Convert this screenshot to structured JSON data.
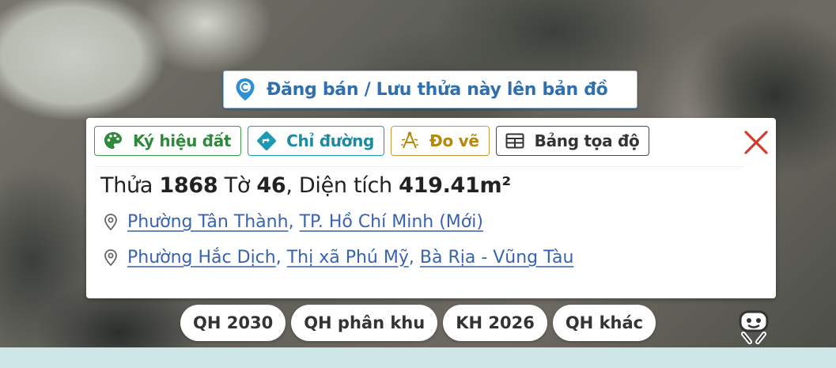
{
  "post_button": {
    "label": "Đăng bán / Lưu thửa này lên bản đồ",
    "icon": "map-pin-coin-icon",
    "color": "#2f6fae"
  },
  "toolbar": {
    "items": [
      {
        "label": "Ký hiệu đất",
        "icon": "palette-icon",
        "color": "#2e8a3b"
      },
      {
        "label": "Chỉ đường",
        "icon": "directions-icon",
        "color": "#1b8aa2"
      },
      {
        "label": "Đo vẽ",
        "icon": "measure-draw-icon",
        "color": "#b8860b"
      },
      {
        "label": "Bảng tọa độ",
        "icon": "table-icon",
        "color": "#333333"
      }
    ],
    "close_icon": "close-icon"
  },
  "parcel": {
    "thua_label": "Thửa",
    "thua_value": "1868",
    "to_label": "Tờ",
    "to_value": "46",
    "dientich_label": ", Diện tích",
    "dientich_value": "419.41m²"
  },
  "addresses": [
    {
      "icon": "location-pin-icon",
      "parts": [
        "Phường Tân Thành",
        "TP. Hồ Chí Minh (Mới)"
      ]
    },
    {
      "icon": "location-pin-icon",
      "parts": [
        "Phường Hắc Dịch",
        "Thị xã Phú Mỹ",
        "Bà Rịa - Vũng Tàu"
      ]
    }
  ],
  "planning_chips": [
    "QH 2030",
    "QH phân khu",
    "KH 2026",
    "QH khác"
  ],
  "street_view_icon": "pegman-icon"
}
